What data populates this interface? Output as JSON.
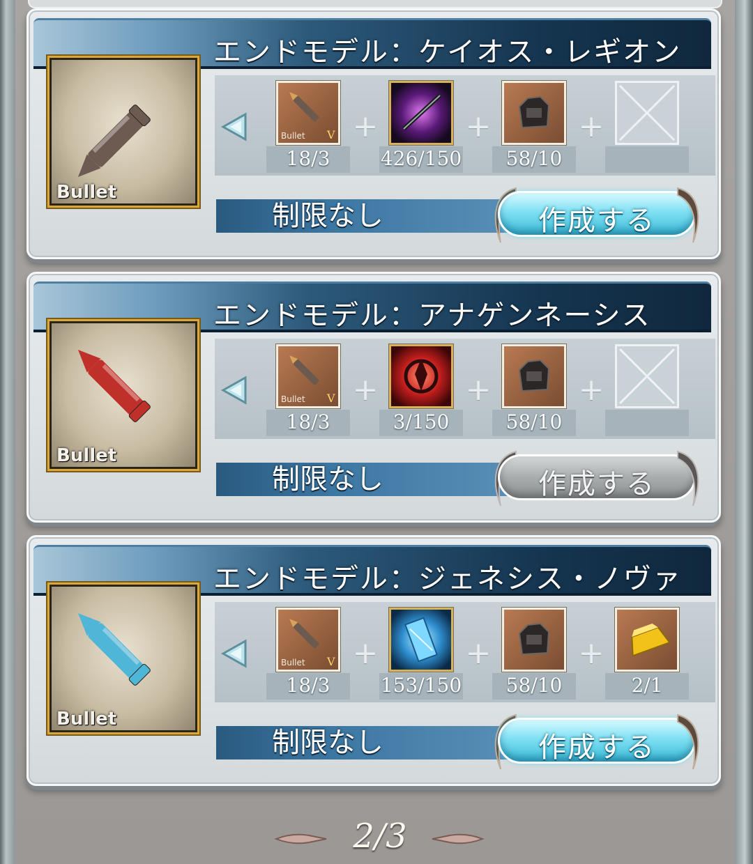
{
  "recipes": [
    {
      "title": "エンドモデル：ケイオス・レギオン",
      "thumb_label": "Bullet",
      "bullet_color": "#6d5a50",
      "materials": [
        {
          "icon": "bullet-v-icon",
          "icon_label": "Bullet",
          "rank": "V",
          "qty": "18/3"
        },
        {
          "icon": "dark-sword-orb-icon",
          "qty": "426/150"
        },
        {
          "icon": "gear-ore-icon",
          "qty": "58/10"
        },
        {
          "icon": "empty-slot-icon",
          "qty": ""
        }
      ],
      "limit": "制限なし",
      "button_label": "作成する",
      "button_enabled": true
    },
    {
      "title": "エンドモデル：アナゲンネーシス",
      "thumb_label": "Bullet",
      "bullet_color": "#c0302a",
      "materials": [
        {
          "icon": "bullet-v-icon",
          "icon_label": "Bullet",
          "rank": "V",
          "qty": "18/3"
        },
        {
          "icon": "red-crest-orb-icon",
          "qty": "3/150"
        },
        {
          "icon": "gear-ore-icon",
          "qty": "58/10"
        },
        {
          "icon": "empty-slot-icon",
          "qty": ""
        }
      ],
      "limit": "制限なし",
      "button_label": "作成する",
      "button_enabled": false
    },
    {
      "title": "エンドモデル：ジェネシス・ノヴァ",
      "thumb_label": "Bullet",
      "bullet_color": "#4fb6d8",
      "materials": [
        {
          "icon": "bullet-v-icon",
          "icon_label": "Bullet",
          "rank": "V",
          "qty": "18/3"
        },
        {
          "icon": "blue-crystal-orb-icon",
          "qty": "153/150"
        },
        {
          "icon": "gear-ore-icon",
          "qty": "58/10"
        },
        {
          "icon": "gold-bar-icon",
          "qty": "2/1"
        }
      ],
      "limit": "制限なし",
      "button_label": "作成する",
      "button_enabled": true
    }
  ],
  "pager": {
    "text": "2/3"
  },
  "colors": {
    "accent_button": "#3cbcd8",
    "title_bar": "#153550",
    "thumb_border": "#d8a93a"
  }
}
